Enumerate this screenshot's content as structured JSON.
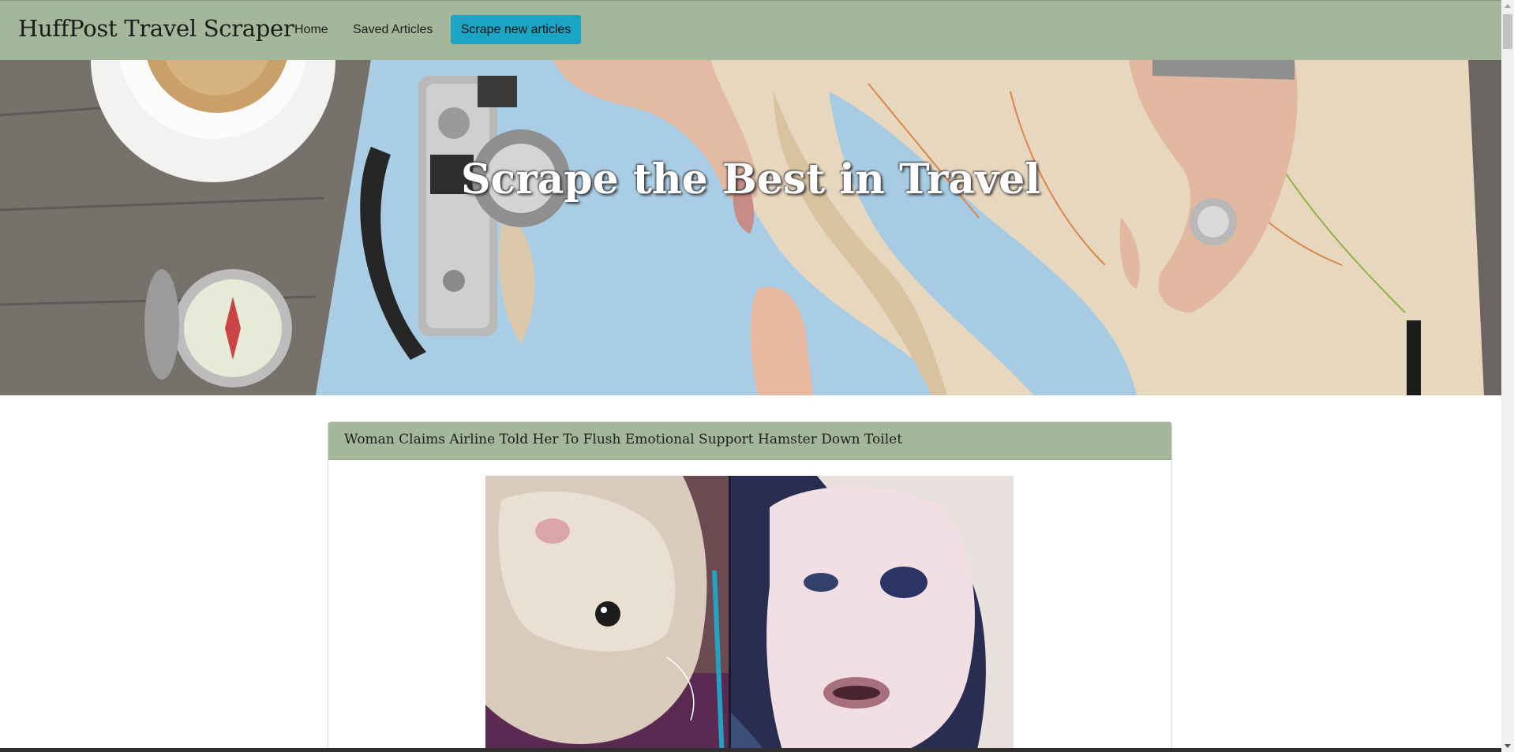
{
  "navbar": {
    "brand": "HuffPost Travel Scraper",
    "links": [
      {
        "label": "Home"
      },
      {
        "label": "Saved Articles"
      }
    ],
    "scrape_button": "Scrape new articles",
    "background_color": "#a5b79b",
    "button_color": "#1aa5c4"
  },
  "hero": {
    "title": "Scrape the Best in Travel"
  },
  "articles": [
    {
      "title": "Woman Claims Airline Told Her To Flush Emotional Support Hamster Down Toilet"
    }
  ]
}
